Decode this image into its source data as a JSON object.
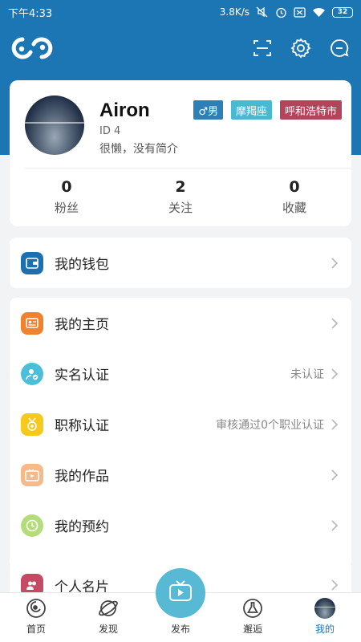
{
  "status_bar": {
    "time": "下午4:33",
    "network_speed": "3.8K/s",
    "battery": "32",
    "icons": [
      "mute-icon",
      "alarm-icon",
      "sim-icon",
      "wifi-icon",
      "battery-icon"
    ]
  },
  "colors": {
    "brand_blue": "#1c76b4",
    "tag_gender": "#2e7fb8",
    "tag_zodiac": "#4bb8d1",
    "tag_city": "#b5445b",
    "publish_button": "#58b9d4"
  },
  "header": {
    "icons": [
      "app-logo-icon",
      "scan-icon",
      "settings-icon",
      "message-icon"
    ]
  },
  "profile": {
    "username": "Airon",
    "user_id": "ID 4",
    "bio": "很懒，没有简介",
    "tags": {
      "gender": "♂男",
      "zodiac": "摩羯座",
      "city": "呼和浩特市"
    },
    "stats": [
      {
        "value": "0",
        "label": "粉丝"
      },
      {
        "value": "2",
        "label": "关注"
      },
      {
        "value": "0",
        "label": "收藏"
      }
    ]
  },
  "menu": {
    "wallet": {
      "label": "我的钱包",
      "icon": "wallet-icon"
    },
    "homepage": {
      "label": "我的主页",
      "icon": "id-card-icon"
    },
    "real_name": {
      "label": "实名认证",
      "value": "未认证",
      "icon": "user-verify-icon"
    },
    "title_cert": {
      "label": "职称认证",
      "value": "审核通过0个职业认证",
      "icon": "medal-icon"
    },
    "works": {
      "label": "我的作品",
      "icon": "video-icon"
    },
    "appointments": {
      "label": "我的预约",
      "icon": "clock-icon"
    },
    "business_card": {
      "label": "个人名片",
      "icon": "contact-icon"
    }
  },
  "bottom_nav": {
    "home": "首页",
    "discover": "发现",
    "publish": "发布",
    "encounter": "邂逅",
    "me": "我的"
  }
}
